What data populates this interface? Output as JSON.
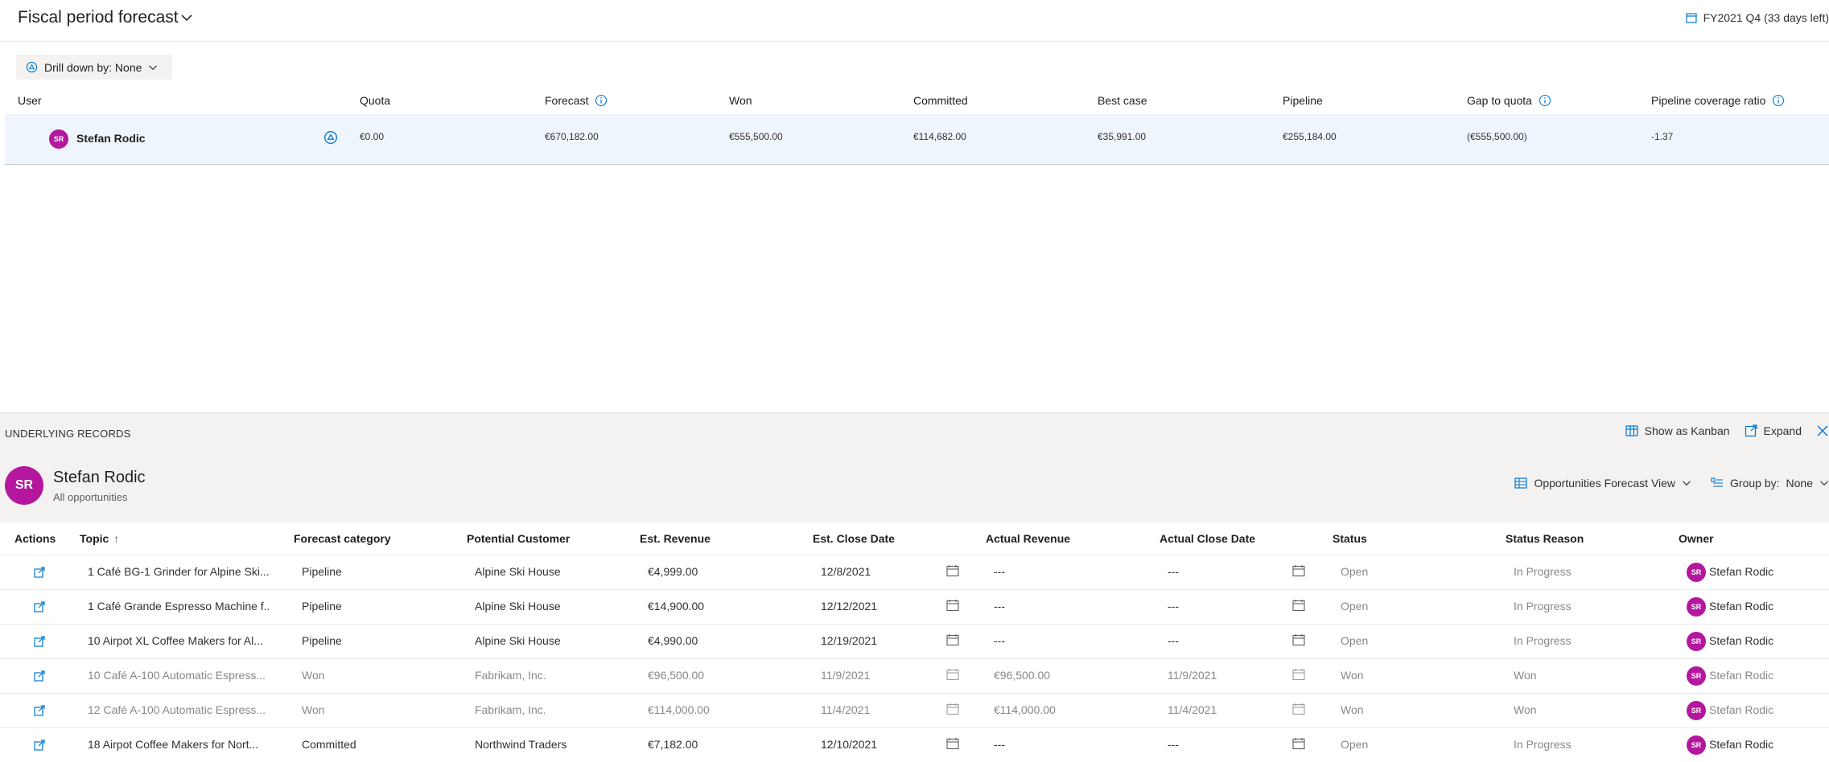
{
  "header": {
    "title": "Fiscal period forecast",
    "period_label": "FY2021 Q4 (33 days left)"
  },
  "drill": {
    "label": "Drill down by: None"
  },
  "forecast": {
    "columns": [
      "User",
      "Quota",
      "Forecast",
      "Won",
      "Committed",
      "Best case",
      "Pipeline",
      "Gap to quota",
      "Pipeline coverage ratio"
    ],
    "row": {
      "initials": "SR",
      "user": "Stefan Rodic",
      "quota": "€0.00",
      "forecast": "€670,182.00",
      "won": "€555,500.00",
      "committed": "€114,682.00",
      "best_case": "€35,991.00",
      "pipeline": "€255,184.00",
      "gap": "(€555,500.00)",
      "coverage": "-1.37"
    }
  },
  "underlying": {
    "title": "UNDERLYING RECORDS",
    "show_kanban": "Show as Kanban",
    "expand": "Expand",
    "user_initials": "SR",
    "user_name": "Stefan Rodic",
    "subtitle": "All opportunities",
    "view_label": "Opportunities Forecast View",
    "group_label": "Group by:",
    "group_value": "None"
  },
  "grid": {
    "columns": [
      "Actions",
      "Topic",
      "Forecast category",
      "Potential Customer",
      "Est. Revenue",
      "Est. Close Date",
      "Actual Revenue",
      "Actual Close Date",
      "Status",
      "Status Reason",
      "Owner"
    ],
    "sort_arrow": "↑",
    "rows": [
      {
        "topic": "1 Café BG-1 Grinder for Alpine Ski...",
        "category": "Pipeline",
        "customer": "Alpine Ski House",
        "est_revenue": "€4,999.00",
        "est_close": "12/8/2021",
        "actual_revenue": "---",
        "actual_close": "---",
        "status": "Open",
        "reason": "In Progress",
        "owner_initials": "SR",
        "owner": "Stefan Rodic",
        "muted": false
      },
      {
        "topic": "1 Café Grande Espresso Machine f...",
        "category": "Pipeline",
        "customer": "Alpine Ski House",
        "est_revenue": "€14,900.00",
        "est_close": "12/12/2021",
        "actual_revenue": "---",
        "actual_close": "---",
        "status": "Open",
        "reason": "In Progress",
        "owner_initials": "SR",
        "owner": "Stefan Rodic",
        "muted": false
      },
      {
        "topic": "10 Airpot XL Coffee Makers for Al...",
        "category": "Pipeline",
        "customer": "Alpine Ski House",
        "est_revenue": "€4,990.00",
        "est_close": "12/19/2021",
        "actual_revenue": "---",
        "actual_close": "---",
        "status": "Open",
        "reason": "In Progress",
        "owner_initials": "SR",
        "owner": "Stefan Rodic",
        "muted": false
      },
      {
        "topic": "10 Café A-100 Automatic Espress...",
        "category": "Won",
        "customer": "Fabrikam, Inc.",
        "est_revenue": "€96,500.00",
        "est_close": "11/9/2021",
        "actual_revenue": "€96,500.00",
        "actual_close": "11/9/2021",
        "status": "Won",
        "reason": "Won",
        "owner_initials": "SR",
        "owner": "Stefan Rodic",
        "muted": true
      },
      {
        "topic": "12 Café A-100 Automatic Espress...",
        "category": "Won",
        "customer": "Fabrikam, Inc.",
        "est_revenue": "€114,000.00",
        "est_close": "11/4/2021",
        "actual_revenue": "€114,000.00",
        "actual_close": "11/4/2021",
        "status": "Won",
        "reason": "Won",
        "owner_initials": "SR",
        "owner": "Stefan Rodic",
        "muted": true
      },
      {
        "topic": "18 Airpot Coffee Makers for Nort...",
        "category": "Committed",
        "customer": "Northwind Traders",
        "est_revenue": "€7,182.00",
        "est_close": "12/10/2021",
        "actual_revenue": "---",
        "actual_close": "---",
        "status": "Open",
        "reason": "In Progress",
        "owner_initials": "SR",
        "owner": "Stefan Rodic",
        "muted": false
      }
    ]
  },
  "colors": {
    "avatar": "#b4179d",
    "accent": "#0078d4",
    "row_highlight": "#eff5fc"
  }
}
